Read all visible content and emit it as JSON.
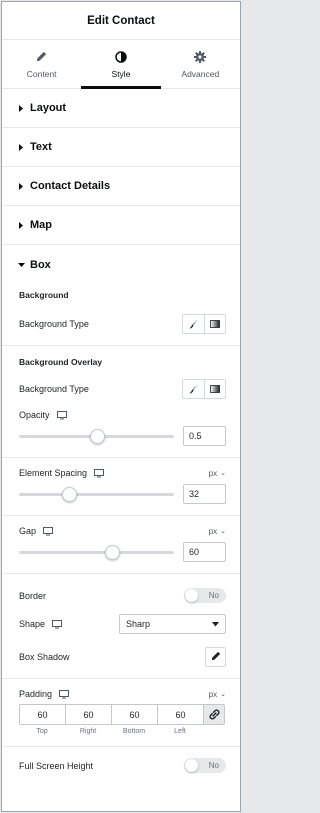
{
  "header": {
    "title": "Edit Contact"
  },
  "tabs": [
    {
      "label": "Content",
      "icon": "pencil-icon"
    },
    {
      "label": "Style",
      "icon": "contrast-icon",
      "active": true
    },
    {
      "label": "Advanced",
      "icon": "gear-icon"
    }
  ],
  "sections": [
    {
      "label": "Layout"
    },
    {
      "label": "Text"
    },
    {
      "label": "Contact Details"
    },
    {
      "label": "Map"
    },
    {
      "label": "Box",
      "expanded": true
    }
  ],
  "box": {
    "background_heading": "Background",
    "background_type_label": "Background Type",
    "overlay_heading": "Background Overlay",
    "overlay_type_label": "Background Type",
    "opacity": {
      "label": "Opacity",
      "value": "0.5",
      "fraction": 0.5
    },
    "element_spacing": {
      "label": "Element Spacing",
      "unit": "px",
      "value": "32",
      "fraction": 0.32
    },
    "gap": {
      "label": "Gap",
      "unit": "px",
      "value": "60",
      "fraction": 0.6
    },
    "border": {
      "label": "Border",
      "toggle": "No"
    },
    "shape": {
      "label": "Shape",
      "value": "Sharp"
    },
    "box_shadow": {
      "label": "Box Shadow"
    },
    "padding": {
      "label": "Padding",
      "unit": "px",
      "values": [
        "60",
        "60",
        "60",
        "60"
      ],
      "sides": [
        "Top",
        "Right",
        "Bottom",
        "Left"
      ]
    },
    "full_screen": {
      "label": "Full Screen Height",
      "toggle": "No"
    }
  },
  "colors": {
    "text": "#1f2124",
    "border": "#c4c8cd",
    "active_tab": "#0c0d0e"
  }
}
